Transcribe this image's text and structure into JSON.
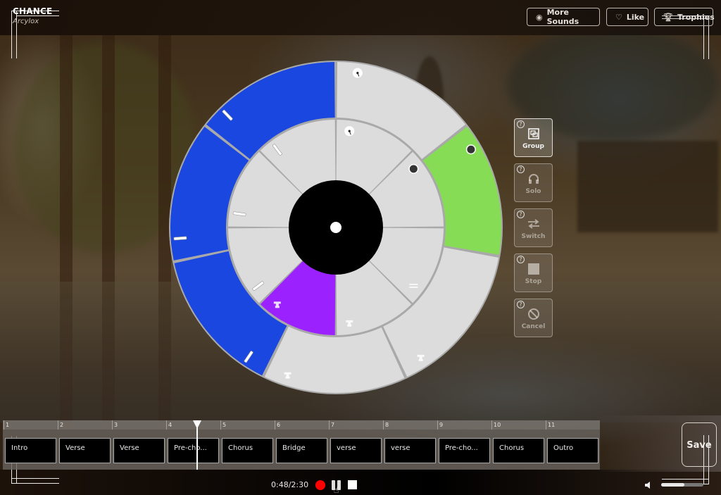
{
  "app": {
    "title": "CHANCE",
    "subtitle": "Arcylox"
  },
  "top_buttons": [
    {
      "label": "More Sounds",
      "icon": "disc-icon"
    },
    {
      "label": "Like",
      "icon": "heart-icon"
    },
    {
      "label": "Trophies",
      "icon": "trophy-icon"
    }
  ],
  "wheel": {
    "colors": {
      "gray": "#dcdcdc",
      "blue": "#1a47e0",
      "green": "#86dd55",
      "purple": "#9b22ff",
      "center": "#000000",
      "divider": "#a9a9a9"
    },
    "outer_ring": [
      {
        "start_deg": 0,
        "end_deg": 52,
        "color": "gray",
        "icon": "dial-icon"
      },
      {
        "start_deg": 52,
        "end_deg": 100,
        "color": "green",
        "icon": "dot-icon"
      },
      {
        "start_deg": 100,
        "end_deg": 155,
        "color": "gray",
        "icon": "trophy-icon"
      },
      {
        "start_deg": 155,
        "end_deg": 206,
        "color": "gray",
        "icon": "trophy-icon"
      },
      {
        "start_deg": 206,
        "end_deg": 258,
        "color": "blue",
        "icon": "slider-icon"
      },
      {
        "start_deg": 258,
        "end_deg": 308,
        "color": "blue",
        "icon": "slider-icon"
      },
      {
        "start_deg": 308,
        "end_deg": 360,
        "color": "blue",
        "icon": "slider-icon"
      }
    ],
    "inner_ring": [
      {
        "start_deg": 0,
        "end_deg": 45,
        "color": "gray",
        "icon": "dial-icon"
      },
      {
        "start_deg": 45,
        "end_deg": 90,
        "color": "gray",
        "icon": "dot-icon"
      },
      {
        "start_deg": 90,
        "end_deg": 135,
        "color": "gray",
        "icon": "equals-icon"
      },
      {
        "start_deg": 135,
        "end_deg": 180,
        "color": "gray",
        "icon": "trophy-icon"
      },
      {
        "start_deg": 180,
        "end_deg": 225,
        "color": "purple",
        "icon": "trophy-icon"
      },
      {
        "start_deg": 225,
        "end_deg": 270,
        "color": "gray",
        "icon": "slider-icon"
      },
      {
        "start_deg": 270,
        "end_deg": 315,
        "color": "gray",
        "icon": "slider-icon"
      },
      {
        "start_deg": 315,
        "end_deg": 360,
        "color": "gray",
        "icon": "slider-icon"
      }
    ]
  },
  "tools": [
    {
      "label": "Group",
      "icon": "group-icon",
      "active": true,
      "help": "?"
    },
    {
      "label": "Solo",
      "icon": "headphones-icon",
      "active": false,
      "help": "?"
    },
    {
      "label": "Switch",
      "icon": "switch-icon",
      "active": false,
      "help": "?"
    },
    {
      "label": "Stop",
      "icon": "stop-icon",
      "active": false,
      "help": "?"
    },
    {
      "label": "Cancel",
      "icon": "cancel-icon",
      "active": false,
      "help": "?"
    }
  ],
  "timeline": {
    "bars": [
      "1",
      "2",
      "3",
      "4",
      "5",
      "6",
      "7",
      "8",
      "9",
      "10",
      "11"
    ],
    "sections": [
      "Intro",
      "Verse",
      "Verse",
      "Pre-cho...",
      "Chorus",
      "Bridge",
      "verse",
      "verse",
      "Pre-cho...",
      "Chorus",
      "Outro"
    ]
  },
  "save_label": "Save",
  "transport": {
    "time": "0:48/2:30",
    "volume_fraction": 0.55
  }
}
